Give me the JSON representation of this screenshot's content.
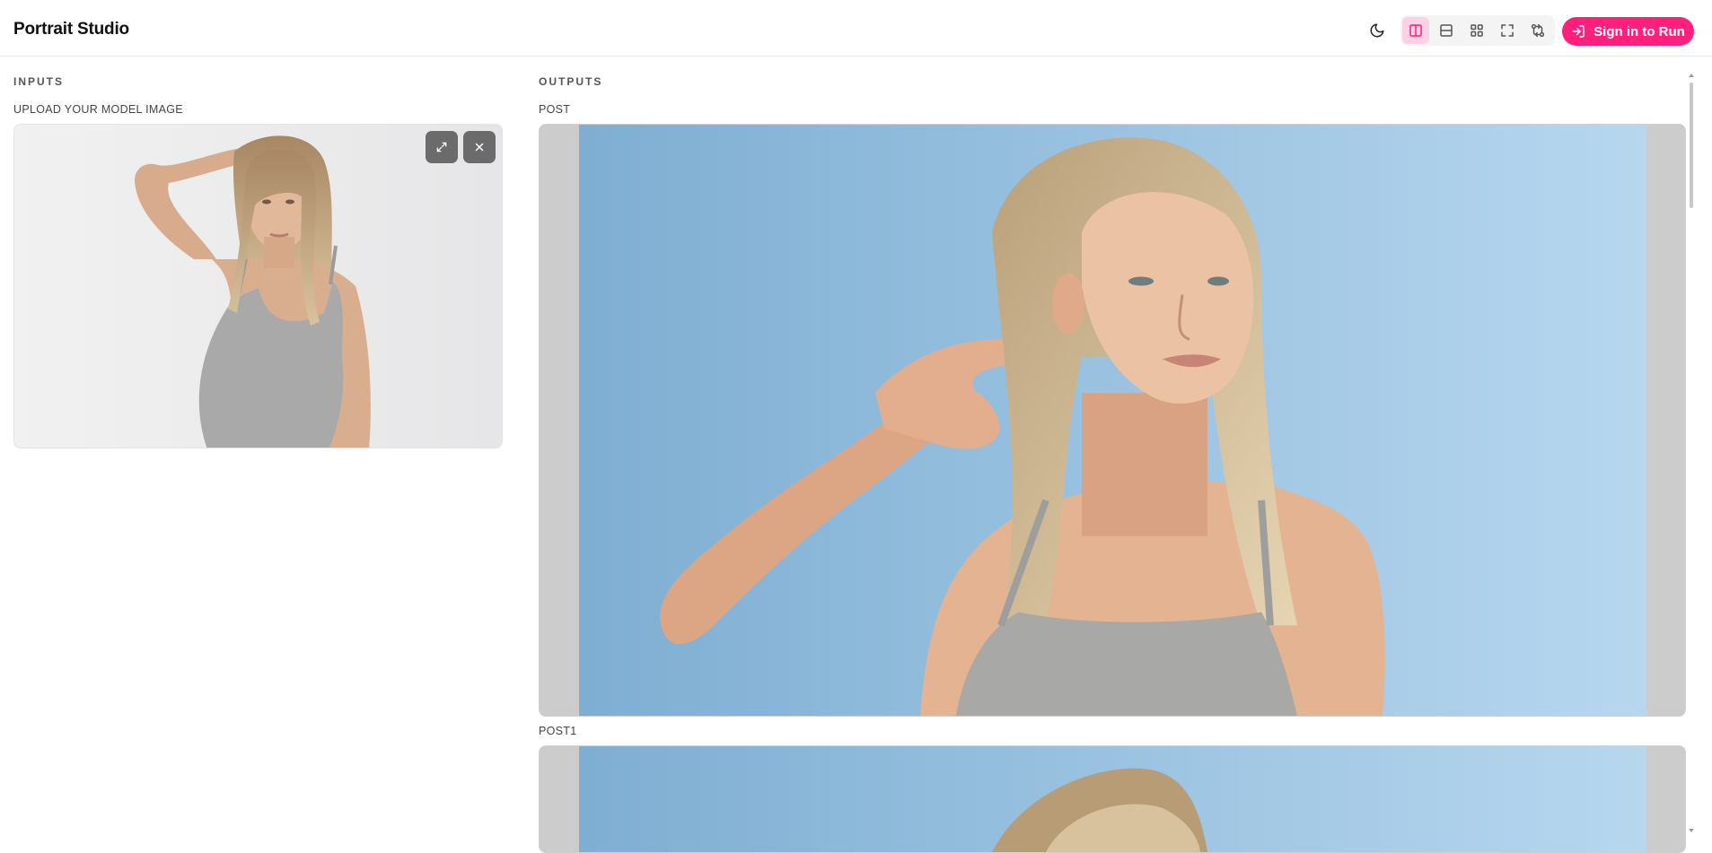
{
  "app": {
    "title": "Portrait Studio"
  },
  "header": {
    "icons": [
      "moon-icon",
      "split-columns-icon",
      "split-rows-icon",
      "grid-icon",
      "fullscreen-icon",
      "compare-icon"
    ],
    "active_view": "split-columns",
    "sign_in_label": "Sign in to Run",
    "accent": "#ff1f7d"
  },
  "inputs": {
    "section_label": "INPUTS",
    "model_image": {
      "label": "UPLOAD YOUR MODEL IMAGE",
      "actions": [
        "expand-icon",
        "close-icon"
      ]
    }
  },
  "outputs": {
    "section_label": "OUTPUTS",
    "items": [
      {
        "label": "POST"
      },
      {
        "label": "POST1"
      }
    ]
  }
}
